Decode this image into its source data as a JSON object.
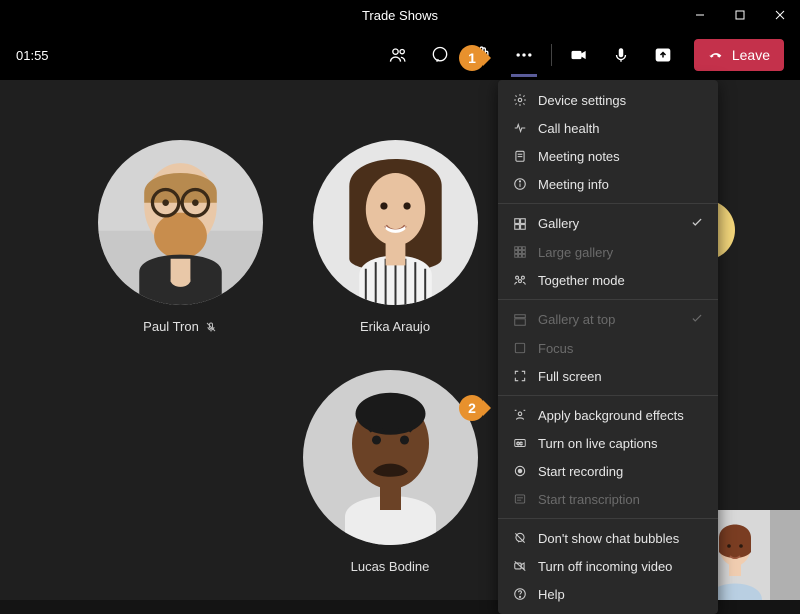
{
  "window": {
    "title": "Trade Shows"
  },
  "toolbar": {
    "timer": "01:55",
    "leave_label": "Leave"
  },
  "participants": {
    "p1": {
      "name": "Paul Tron",
      "muted": true
    },
    "p2": {
      "name": "Erika Araujo",
      "muted": false
    },
    "p3": {
      "name": "Lucas Bodine",
      "muted": false
    }
  },
  "menu": {
    "device_settings": "Device settings",
    "call_health": "Call health",
    "meeting_notes": "Meeting notes",
    "meeting_info": "Meeting info",
    "gallery": "Gallery",
    "large_gallery": "Large gallery",
    "together_mode": "Together mode",
    "gallery_at_top": "Gallery at top",
    "focus": "Focus",
    "full_screen": "Full screen",
    "apply_bg": "Apply background effects",
    "live_captions": "Turn on live captions",
    "start_recording": "Start recording",
    "start_transcription": "Start transcription",
    "dont_show_chat": "Don't show chat bubbles",
    "turn_off_video": "Turn off incoming video",
    "help": "Help"
  },
  "callouts": {
    "one": "1",
    "two": "2"
  }
}
